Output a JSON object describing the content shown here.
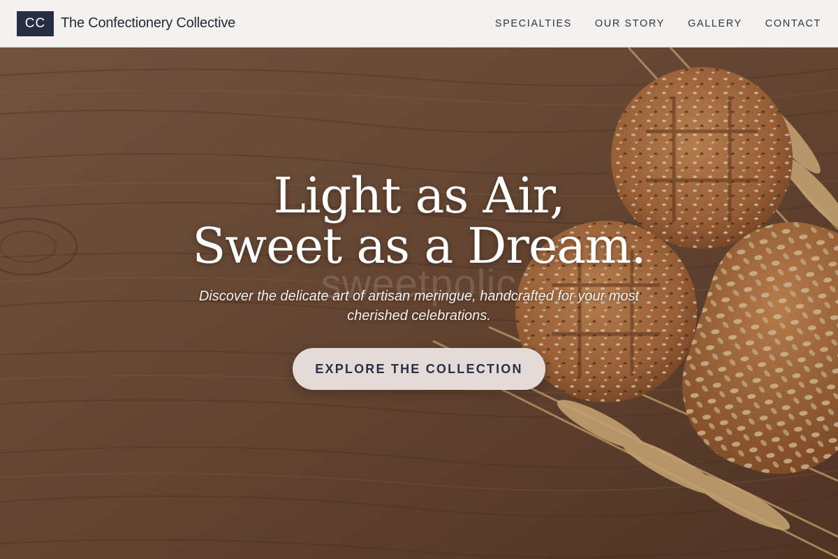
{
  "header": {
    "logo_text": "CC",
    "brand_name": "The Confectionery Collective",
    "nav": [
      "SPECIALTIES",
      "OUR STORY",
      "GALLERY",
      "CONTACT"
    ]
  },
  "hero": {
    "headline_line1": "Light as Air,",
    "headline_line2": "Sweet as a Dream.",
    "watermark": "sweetpolic",
    "subtext": "Discover the delicate art of artisan meringue, handcrafted for your most cherished celebrations.",
    "cta_label": "EXPLORE THE COLLECTION",
    "background_image": "bread-rolls-and-wheat-on-wooden-table"
  },
  "colors": {
    "header_bg": "#f4f2ef",
    "logo_bg": "#252e42",
    "text_dark": "#232a3a",
    "cta_bg": "#e4dad7",
    "wood": "#6b4a34"
  }
}
